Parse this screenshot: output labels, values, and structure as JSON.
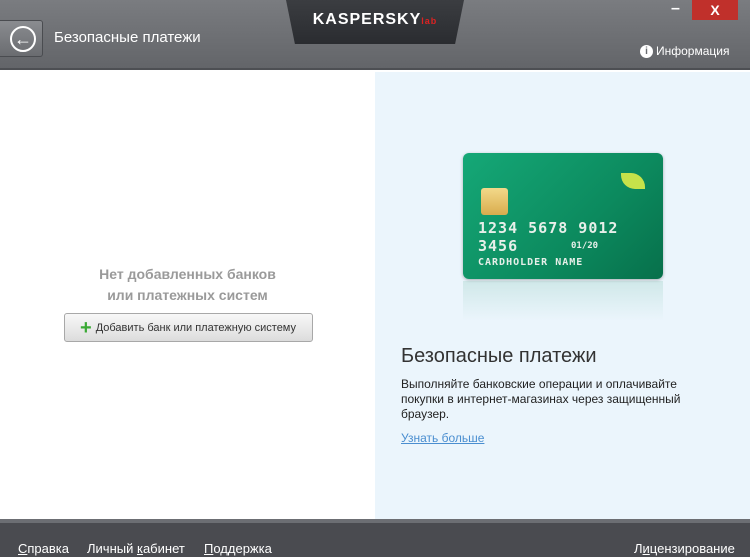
{
  "header": {
    "title": "Безопасные платежи",
    "logo": "KASPERSKY",
    "logo_suffix": "lab",
    "minimize": "–",
    "close": "X",
    "info": "Информация",
    "info_icon": "info-icon",
    "back_icon": "arrow-left-circle-icon"
  },
  "left": {
    "empty_line1": "Нет добавленных банков",
    "empty_line2": "или платежных систем",
    "add_button": "Добавить банк или платежную систему",
    "add_icon": "plus-icon"
  },
  "card": {
    "number": "1234 5678 9012 3456",
    "expiry": "01/20",
    "holder": "CARDHOLDER NAME",
    "color": "#0c8a5e"
  },
  "right": {
    "title": "Безопасные платежи",
    "description": "Выполняйте банковские операции и оплачивайте покупки в интернет-магазинах через защищенный браузер.",
    "learn_more": "Узнать больше"
  },
  "footer": {
    "links": [
      {
        "pre": "",
        "key": "С",
        "post": "правка"
      },
      {
        "pre": "Личный ",
        "key": "к",
        "post": "абинет"
      },
      {
        "pre": "",
        "key": "П",
        "post": "оддержка"
      },
      {
        "pre": "Л",
        "key": "и",
        "post": "цензирование"
      }
    ]
  }
}
